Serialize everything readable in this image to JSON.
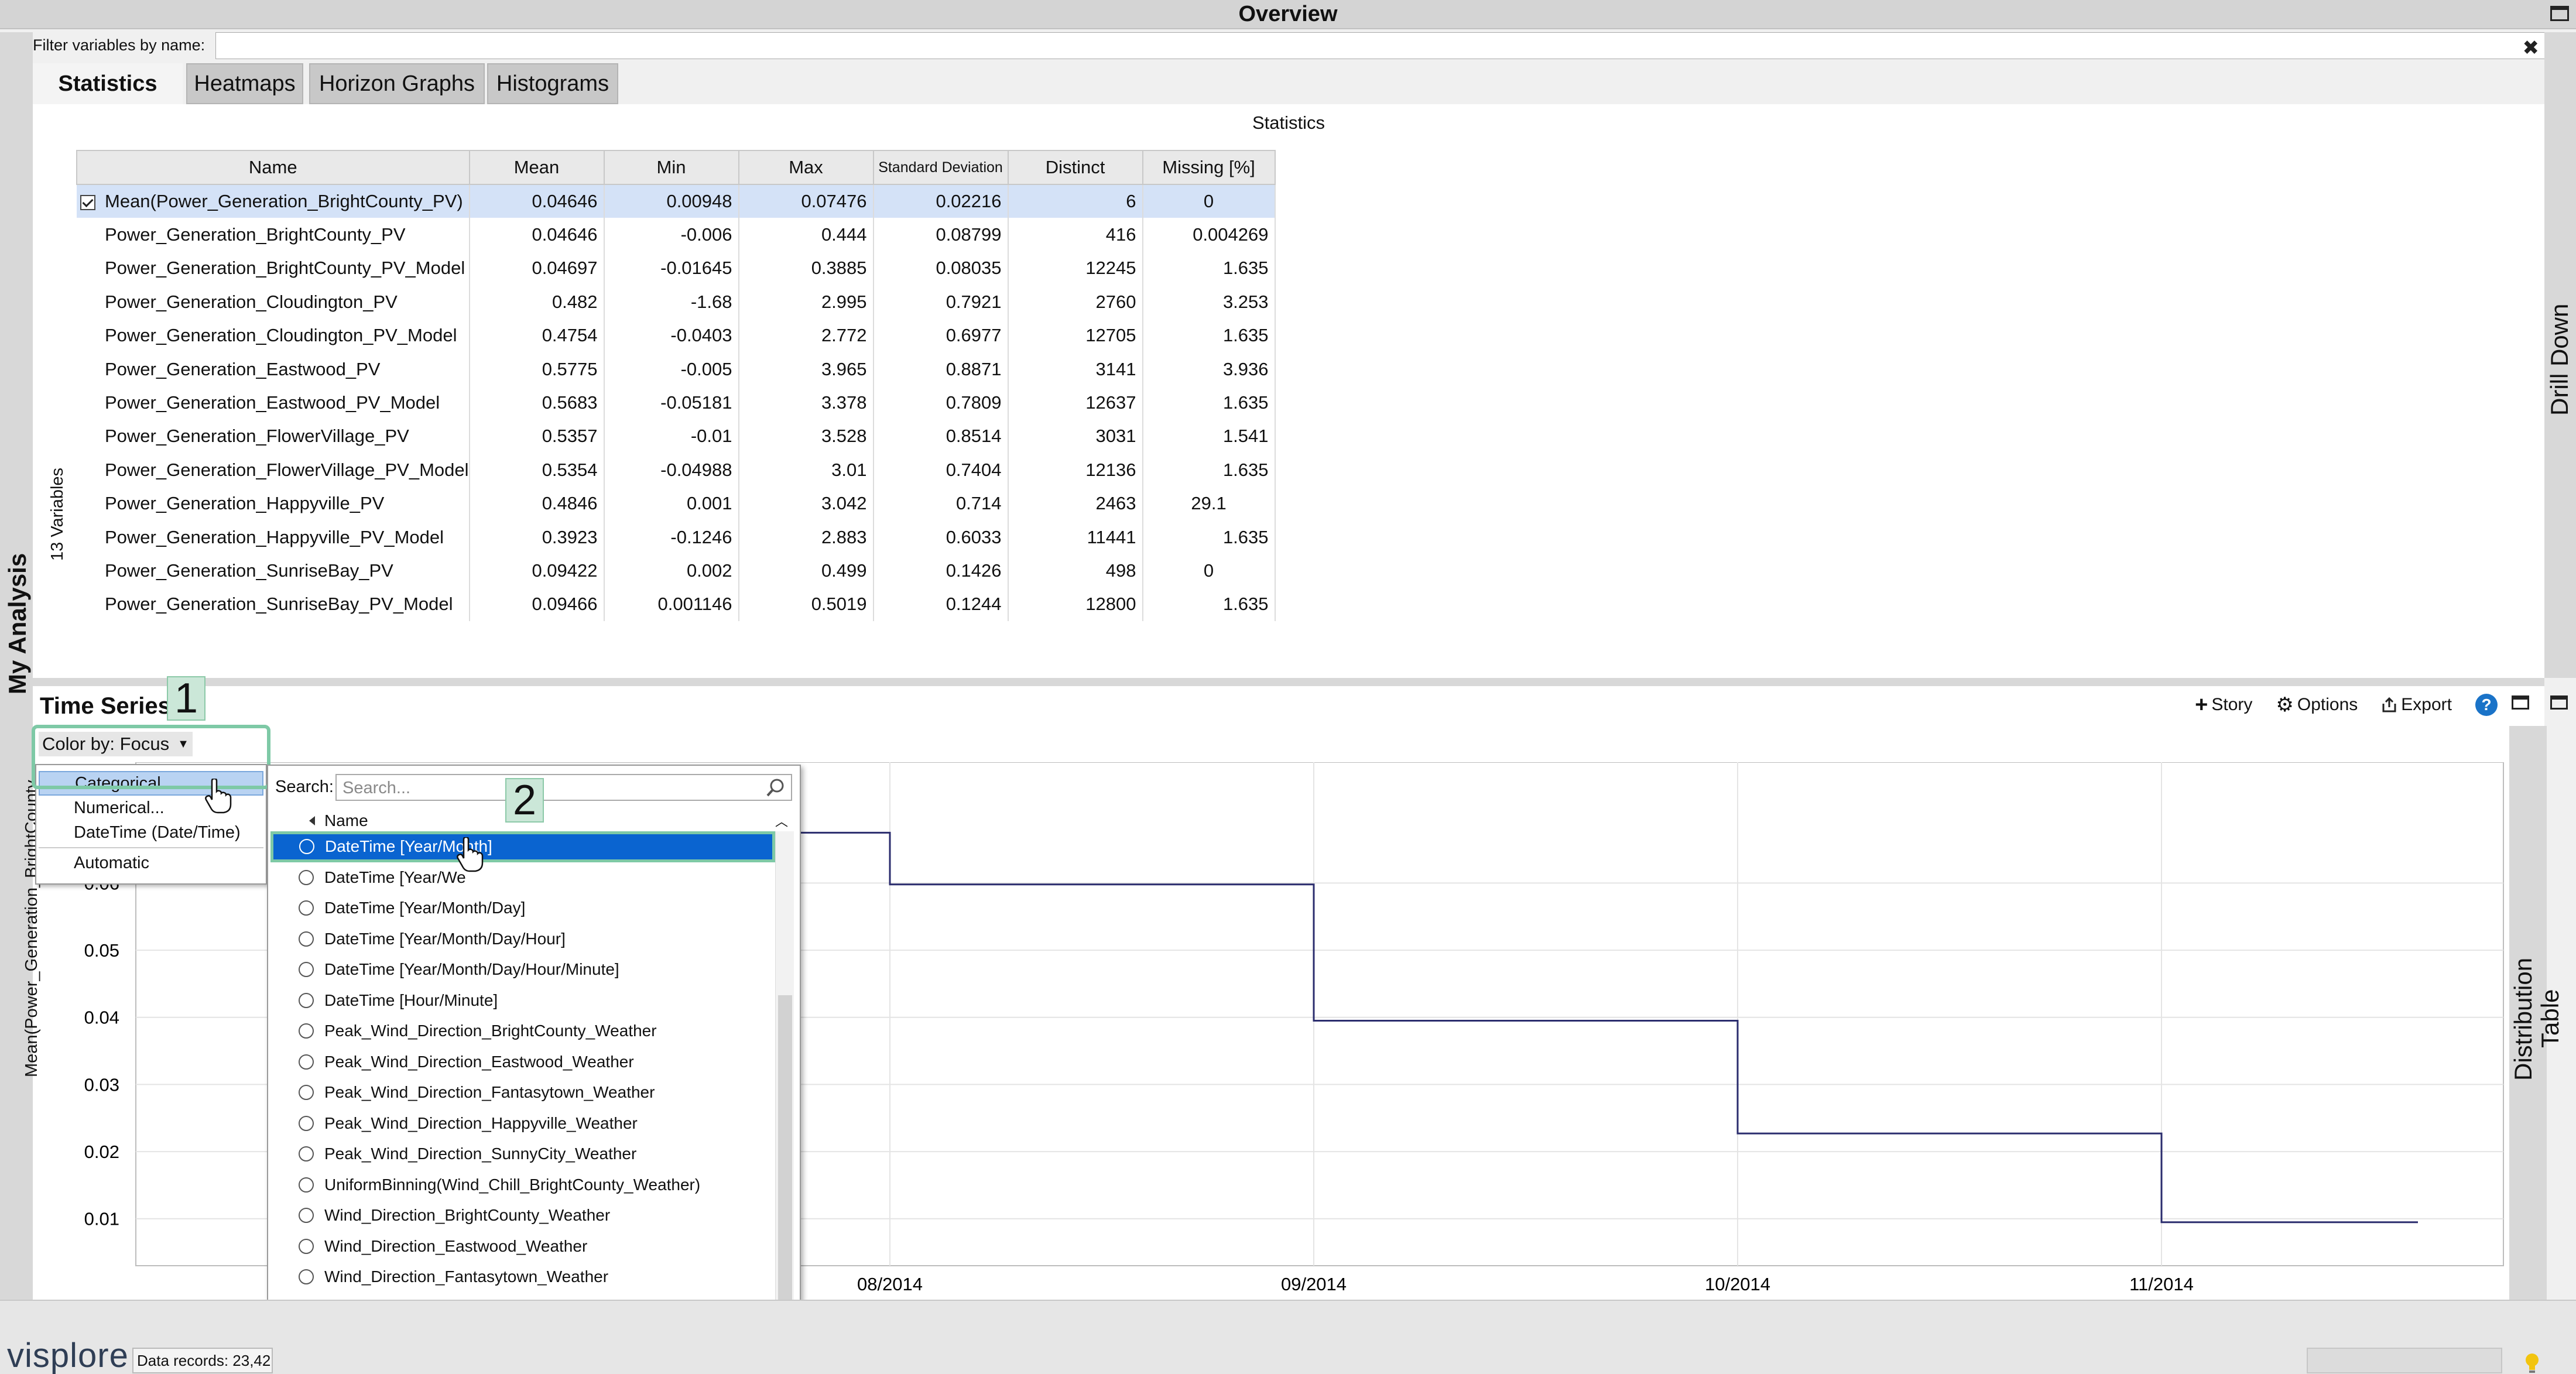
{
  "window": {
    "title": "Overview"
  },
  "filter": {
    "label": "Filter variables by name:",
    "value": "",
    "clear_icon": "close-icon"
  },
  "tabs": [
    {
      "label": "Statistics",
      "active": true
    },
    {
      "label": "Heatmaps",
      "active": false
    },
    {
      "label": "Horizon Graphs",
      "active": false
    },
    {
      "label": "Histograms",
      "active": false
    }
  ],
  "statistics": {
    "title": "Statistics",
    "variables_count_label": "13 Variables",
    "columns": [
      "Name",
      "Mean",
      "Min",
      "Max",
      "Standard Deviation",
      "Distinct",
      "Missing [%]"
    ],
    "rows": [
      {
        "checked": true,
        "name": "Mean(Power_Generation_BrightCounty_PV)",
        "mean": "0.04646",
        "min": "0.00948",
        "max": "0.07476",
        "std": "0.02216",
        "distinct": "6",
        "missing": "0"
      },
      {
        "name": "Power_Generation_BrightCounty_PV",
        "mean": "0.04646",
        "min": "-0.006",
        "max": "0.444",
        "std": "0.08799",
        "distinct": "416",
        "missing": "0.004269"
      },
      {
        "name": "Power_Generation_BrightCounty_PV_Model",
        "mean": "0.04697",
        "min": "-0.01645",
        "max": "0.3885",
        "std": "0.08035",
        "distinct": "12245",
        "missing": "1.635"
      },
      {
        "name": "Power_Generation_Cloudington_PV",
        "mean": "0.482",
        "min": "-1.68",
        "max": "2.995",
        "std": "0.7921",
        "distinct": "2760",
        "missing": "3.253"
      },
      {
        "name": "Power_Generation_Cloudington_PV_Model",
        "mean": "0.4754",
        "min": "-0.0403",
        "max": "2.772",
        "std": "0.6977",
        "distinct": "12705",
        "missing": "1.635"
      },
      {
        "name": "Power_Generation_Eastwood_PV",
        "mean": "0.5775",
        "min": "-0.005",
        "max": "3.965",
        "std": "0.8871",
        "distinct": "3141",
        "missing": "3.936"
      },
      {
        "name": "Power_Generation_Eastwood_PV_Model",
        "mean": "0.5683",
        "min": "-0.05181",
        "max": "3.378",
        "std": "0.7809",
        "distinct": "12637",
        "missing": "1.635"
      },
      {
        "name": "Power_Generation_FlowerVillage_PV",
        "mean": "0.5357",
        "min": "-0.01",
        "max": "3.528",
        "std": "0.8514",
        "distinct": "3031",
        "missing": "1.541"
      },
      {
        "name": "Power_Generation_FlowerVillage_PV_Model",
        "mean": "0.5354",
        "min": "-0.04988",
        "max": "3.01",
        "std": "0.7404",
        "distinct": "12136",
        "missing": "1.635"
      },
      {
        "name": "Power_Generation_Happyville_PV",
        "mean": "0.4846",
        "min": "0.001",
        "max": "3.042",
        "std": "0.714",
        "distinct": "2463",
        "missing": "29.1"
      },
      {
        "name": "Power_Generation_Happyville_PV_Model",
        "mean": "0.3923",
        "min": "-0.1246",
        "max": "2.883",
        "std": "0.6033",
        "distinct": "11441",
        "missing": "1.635"
      },
      {
        "name": "Power_Generation_SunriseBay_PV",
        "mean": "0.09422",
        "min": "0.002",
        "max": "0.499",
        "std": "0.1426",
        "distinct": "498",
        "missing": "0"
      },
      {
        "name": "Power_Generation_SunriseBay_PV_Model",
        "mean": "0.09466",
        "min": "0.001146",
        "max": "0.5019",
        "std": "0.1244",
        "distinct": "12800",
        "missing": "1.635"
      }
    ]
  },
  "side_labels": {
    "left": "My Analysis",
    "drill_down": "Drill Down",
    "distribution_1": "Distribution",
    "distribution_2": "Table"
  },
  "time_series": {
    "title": "Time Series",
    "actions": {
      "story": "Story",
      "options": "Options",
      "export": "Export",
      "help": "?"
    },
    "color_by_label": "Color by: Focus",
    "color_by_menu": [
      "Categorical...",
      "Numerical...",
      "DateTime (Date/Time)",
      "Automatic"
    ],
    "color_by_highlighted": "Categorical..."
  },
  "categorical_popup": {
    "search_label": "Search:",
    "search_placeholder": "Search...",
    "column_header": "Name",
    "items": [
      "DateTime [Year/Month]",
      "DateTime [Year/Week]",
      "DateTime [Year/Month/Day]",
      "DateTime [Year/Month/Day/Hour]",
      "DateTime [Year/Month/Day/Hour/Minute]",
      "DateTime [Hour/Minute]",
      "Peak_Wind_Direction_BrightCounty_Weather",
      "Peak_Wind_Direction_Eastwood_Weather",
      "Peak_Wind_Direction_Fantasytown_Weather",
      "Peak_Wind_Direction_Happyville_Weather",
      "Peak_Wind_Direction_SunnyCity_Weather",
      "UniformBinning(Wind_Chill_BrightCounty_Weather)",
      "Wind_Direction_BrightCounty_Weather",
      "Wind_Direction_Eastwood_Weather",
      "Wind_Direction_Fantasytown_Weather",
      "Wind_Direction_Happyville_Weather",
      "Wind_Direction_SunnyCity_Weather"
    ],
    "selected_index": 0,
    "selected_visible_text": "DateTime [Year/Month]",
    "obscured_item_visible_text": "DateTime [Year/We"
  },
  "annotations": {
    "marker_1": "1",
    "marker_2": "2"
  },
  "chart_data": {
    "type": "line",
    "step": true,
    "xlabel": "DateTime",
    "ylabel": "Mean(Power_Generation_BrightCounty",
    "x_ticks": [
      "08/2014",
      "09/2014",
      "10/2014",
      "11/2014"
    ],
    "y_ticks": [
      "0.06",
      "0.05",
      "0.04",
      "0.03",
      "0.02",
      "0.01"
    ],
    "ylim": [
      0.003,
      0.078
    ],
    "series": [
      {
        "color": "#2b2d6e",
        "points": [
          {
            "x": "07/2014",
            "y": 0.0675
          },
          {
            "x": "08/2014",
            "y": 0.0598
          },
          {
            "x": "09/2014",
            "y": 0.0395
          },
          {
            "x": "10/2014",
            "y": 0.0227
          },
          {
            "x": "11/2014",
            "y": 0.00948
          }
        ]
      }
    ],
    "grid": true
  },
  "status": {
    "logo": "visplore",
    "records": "Data records: 23,42"
  },
  "icons": {
    "story": "plus-icon",
    "options": "gear-icon",
    "export": "export-icon",
    "help": "help-icon",
    "search": "search-icon",
    "tip": "lightbulb-icon"
  }
}
